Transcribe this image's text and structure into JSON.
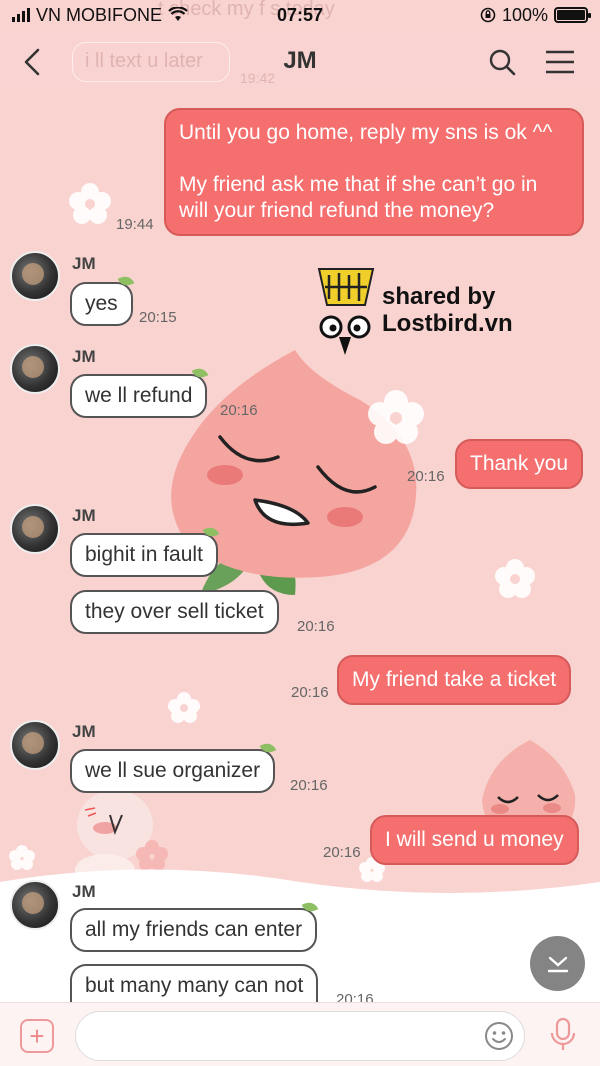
{
  "status": {
    "carrier": "VN MOBIFONE",
    "time": "07:57",
    "battery": "100%",
    "battery_level": 1.0
  },
  "header": {
    "title": "JM",
    "faded_top": "t check my f    s today",
    "faded_later": "i ll text u later",
    "faded_time": "19:42"
  },
  "watermark": {
    "line1": "shared by",
    "line2": "Lostbird.vn"
  },
  "messages": [
    {
      "id": "m1",
      "dir": "out",
      "lines": [
        "Until you go home, reply my sns is ok ^^",
        "",
        "My friend ask me that if she can’t go in",
        "will your friend refund the money?"
      ],
      "time": "19:44"
    },
    {
      "id": "m2",
      "dir": "in",
      "sender": "JM",
      "text": "yes",
      "time": "20:15"
    },
    {
      "id": "m3",
      "dir": "in",
      "sender": "JM",
      "text": "we ll refund",
      "time": "20:16"
    },
    {
      "id": "m4",
      "dir": "out",
      "text": "Thank you",
      "time": "20:16"
    },
    {
      "id": "m5",
      "dir": "in",
      "sender": "JM",
      "texts": [
        "bighit in fault",
        "they over sell ticket"
      ],
      "time": "20:16"
    },
    {
      "id": "m6",
      "dir": "out",
      "text": "My friend take a ticket",
      "time": "20:16"
    },
    {
      "id": "m7",
      "dir": "in",
      "sender": "JM",
      "text": "we ll sue organizer",
      "time": "20:16"
    },
    {
      "id": "m8",
      "dir": "out",
      "text": "I will send u money",
      "time": "20:16"
    },
    {
      "id": "m9",
      "dir": "in",
      "sender": "JM",
      "texts": [
        "all my friends can enter",
        "but many many can not"
      ],
      "time": "20:16"
    }
  ],
  "composer": {
    "placeholder": ""
  },
  "colors": {
    "background": "#f8d3d0",
    "bubble_out": "#f56f6f",
    "bubble_in": "#ffffff"
  }
}
